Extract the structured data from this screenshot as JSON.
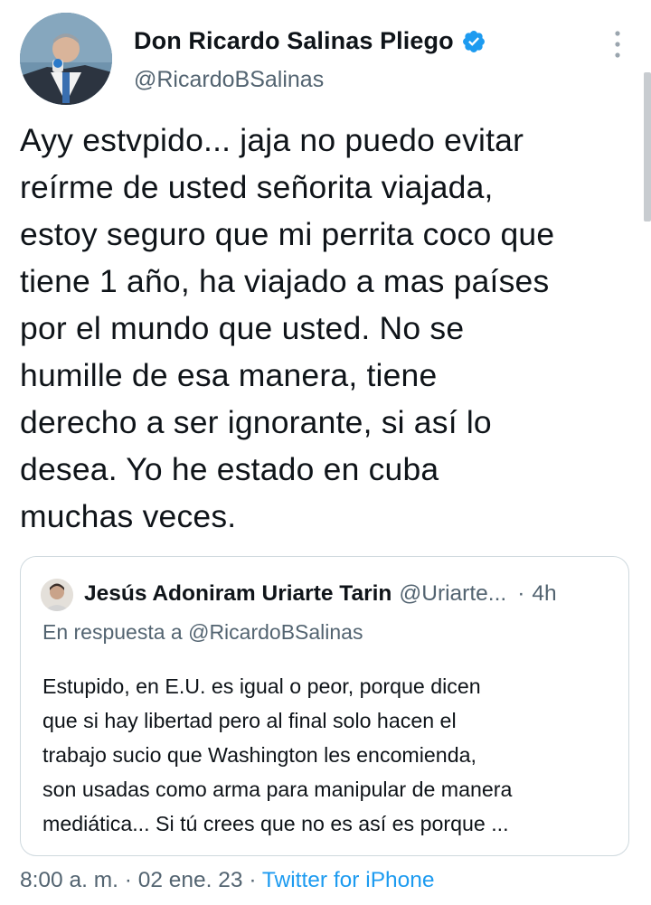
{
  "tweet": {
    "author": {
      "name": "Don Ricardo Salinas Pliego",
      "handle": "@RicardoBSalinas"
    },
    "text": "Ayy estvpido... jaja no puedo evitar\nreírme de usted señorita viajada,\nestoy seguro que mi perrita coco que\ntiene 1 año, ha viajado a mas países\npor el mundo que usted. No se\nhumille de esa manera, tiene\nderecho a ser ignorante, si así lo\ndesea. Yo he estado en cuba\nmuchas veces.",
    "quoted": {
      "author": {
        "name": "Jesús Adoniram Uriarte Tarin",
        "handle": "@Uriarte..."
      },
      "separator": "·",
      "time": "4h",
      "reply_to": "En respuesta a @RicardoBSalinas",
      "text": "Estupido, en E.U. es igual o peor, porque dicen\nque si hay libertad pero al final solo hacen el\ntrabajo sucio que Washington les encomienda,\nson usadas como arma para manipular de manera\nmediática... Si tú crees que no es así es porque ..."
    },
    "meta": {
      "time": "8:00 a. m.",
      "separator": "·",
      "date": "02 ene. 23",
      "source": "Twitter for iPhone"
    }
  },
  "icons": {
    "verified": "verified-badge-icon",
    "more": "more-vertical-icon"
  },
  "colors": {
    "accent": "#1d9bf0",
    "secondary_text": "#536471",
    "primary_text": "#0f1419",
    "border": "#cfd9de"
  }
}
